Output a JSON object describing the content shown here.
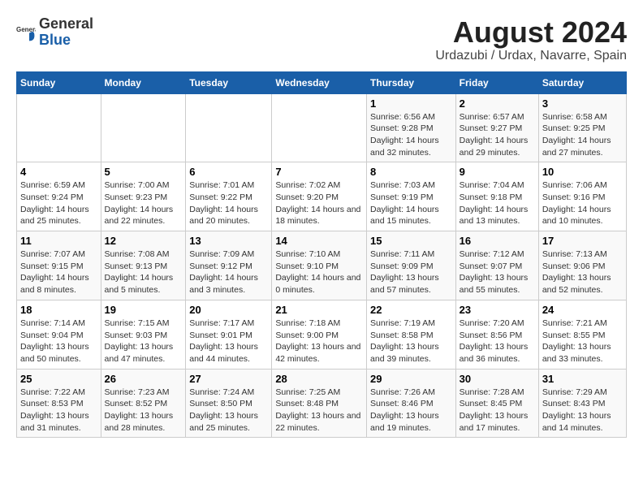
{
  "logo": {
    "general": "General",
    "blue": "Blue"
  },
  "title": "August 2024",
  "subtitle": "Urdazubi / Urdax, Navarre, Spain",
  "days_of_week": [
    "Sunday",
    "Monday",
    "Tuesday",
    "Wednesday",
    "Thursday",
    "Friday",
    "Saturday"
  ],
  "weeks": [
    [
      {
        "day": "",
        "info": ""
      },
      {
        "day": "",
        "info": ""
      },
      {
        "day": "",
        "info": ""
      },
      {
        "day": "",
        "info": ""
      },
      {
        "day": "1",
        "info": "Sunrise: 6:56 AM\nSunset: 9:28 PM\nDaylight: 14 hours and 32 minutes."
      },
      {
        "day": "2",
        "info": "Sunrise: 6:57 AM\nSunset: 9:27 PM\nDaylight: 14 hours and 29 minutes."
      },
      {
        "day": "3",
        "info": "Sunrise: 6:58 AM\nSunset: 9:25 PM\nDaylight: 14 hours and 27 minutes."
      }
    ],
    [
      {
        "day": "4",
        "info": "Sunrise: 6:59 AM\nSunset: 9:24 PM\nDaylight: 14 hours and 25 minutes."
      },
      {
        "day": "5",
        "info": "Sunrise: 7:00 AM\nSunset: 9:23 PM\nDaylight: 14 hours and 22 minutes."
      },
      {
        "day": "6",
        "info": "Sunrise: 7:01 AM\nSunset: 9:22 PM\nDaylight: 14 hours and 20 minutes."
      },
      {
        "day": "7",
        "info": "Sunrise: 7:02 AM\nSunset: 9:20 PM\nDaylight: 14 hours and 18 minutes."
      },
      {
        "day": "8",
        "info": "Sunrise: 7:03 AM\nSunset: 9:19 PM\nDaylight: 14 hours and 15 minutes."
      },
      {
        "day": "9",
        "info": "Sunrise: 7:04 AM\nSunset: 9:18 PM\nDaylight: 14 hours and 13 minutes."
      },
      {
        "day": "10",
        "info": "Sunrise: 7:06 AM\nSunset: 9:16 PM\nDaylight: 14 hours and 10 minutes."
      }
    ],
    [
      {
        "day": "11",
        "info": "Sunrise: 7:07 AM\nSunset: 9:15 PM\nDaylight: 14 hours and 8 minutes."
      },
      {
        "day": "12",
        "info": "Sunrise: 7:08 AM\nSunset: 9:13 PM\nDaylight: 14 hours and 5 minutes."
      },
      {
        "day": "13",
        "info": "Sunrise: 7:09 AM\nSunset: 9:12 PM\nDaylight: 14 hours and 3 minutes."
      },
      {
        "day": "14",
        "info": "Sunrise: 7:10 AM\nSunset: 9:10 PM\nDaylight: 14 hours and 0 minutes."
      },
      {
        "day": "15",
        "info": "Sunrise: 7:11 AM\nSunset: 9:09 PM\nDaylight: 13 hours and 57 minutes."
      },
      {
        "day": "16",
        "info": "Sunrise: 7:12 AM\nSunset: 9:07 PM\nDaylight: 13 hours and 55 minutes."
      },
      {
        "day": "17",
        "info": "Sunrise: 7:13 AM\nSunset: 9:06 PM\nDaylight: 13 hours and 52 minutes."
      }
    ],
    [
      {
        "day": "18",
        "info": "Sunrise: 7:14 AM\nSunset: 9:04 PM\nDaylight: 13 hours and 50 minutes."
      },
      {
        "day": "19",
        "info": "Sunrise: 7:15 AM\nSunset: 9:03 PM\nDaylight: 13 hours and 47 minutes."
      },
      {
        "day": "20",
        "info": "Sunrise: 7:17 AM\nSunset: 9:01 PM\nDaylight: 13 hours and 44 minutes."
      },
      {
        "day": "21",
        "info": "Sunrise: 7:18 AM\nSunset: 9:00 PM\nDaylight: 13 hours and 42 minutes."
      },
      {
        "day": "22",
        "info": "Sunrise: 7:19 AM\nSunset: 8:58 PM\nDaylight: 13 hours and 39 minutes."
      },
      {
        "day": "23",
        "info": "Sunrise: 7:20 AM\nSunset: 8:56 PM\nDaylight: 13 hours and 36 minutes."
      },
      {
        "day": "24",
        "info": "Sunrise: 7:21 AM\nSunset: 8:55 PM\nDaylight: 13 hours and 33 minutes."
      }
    ],
    [
      {
        "day": "25",
        "info": "Sunrise: 7:22 AM\nSunset: 8:53 PM\nDaylight: 13 hours and 31 minutes."
      },
      {
        "day": "26",
        "info": "Sunrise: 7:23 AM\nSunset: 8:52 PM\nDaylight: 13 hours and 28 minutes."
      },
      {
        "day": "27",
        "info": "Sunrise: 7:24 AM\nSunset: 8:50 PM\nDaylight: 13 hours and 25 minutes."
      },
      {
        "day": "28",
        "info": "Sunrise: 7:25 AM\nSunset: 8:48 PM\nDaylight: 13 hours and 22 minutes."
      },
      {
        "day": "29",
        "info": "Sunrise: 7:26 AM\nSunset: 8:46 PM\nDaylight: 13 hours and 19 minutes."
      },
      {
        "day": "30",
        "info": "Sunrise: 7:28 AM\nSunset: 8:45 PM\nDaylight: 13 hours and 17 minutes."
      },
      {
        "day": "31",
        "info": "Sunrise: 7:29 AM\nSunset: 8:43 PM\nDaylight: 13 hours and 14 minutes."
      }
    ]
  ]
}
